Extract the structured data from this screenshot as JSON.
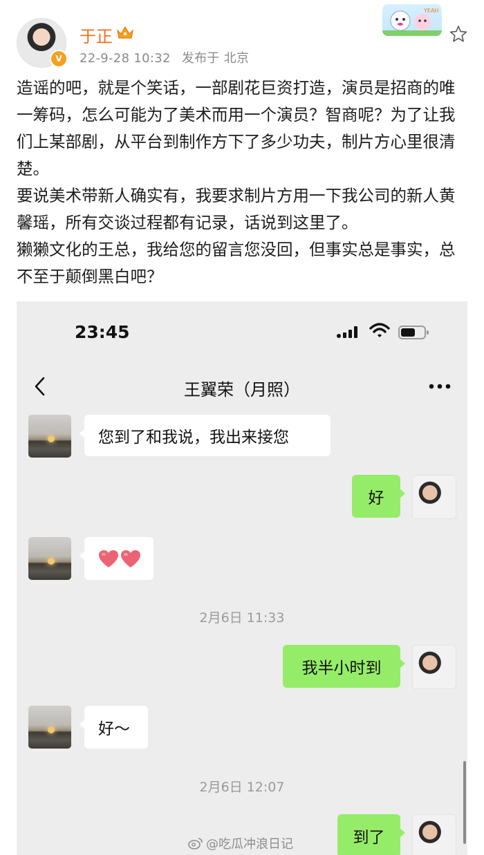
{
  "post": {
    "author": "于正",
    "date": "22-9-28 10:32",
    "source": "发布于 北京",
    "paragraphs": [
      "造谣的吧，就是个笑话，一部剧花巨资打造，演员是招商的唯一筹码，怎么可能为了美术而用一个演员？智商呢？为了让我们上某部剧，从平台到制作方下了多少功夫，制片方心里很清楚。",
      "要说美术带新人确实有，我要求制片方用一下我公司的新人黄馨瑶，所有交谈过程都有记录，话说到这里了。",
      "獭獭文化的王总，我给您的留言您没回，但事实总是事实，总不至于颠倒黑白吧？"
    ]
  },
  "chat": {
    "status_time": "23:45",
    "title": "王翼荣（月照）",
    "messages": [
      {
        "from": "contact",
        "text": "您到了和我说，我出来接您"
      },
      {
        "from": "me",
        "text": "好"
      },
      {
        "from": "contact",
        "text": "",
        "emoji": "hearts"
      },
      {
        "timestamp": "2月6日 11:33"
      },
      {
        "from": "me",
        "text": "我半小时到"
      },
      {
        "from": "contact",
        "text": "好～"
      },
      {
        "timestamp": "2月6日 12:07"
      },
      {
        "from": "me",
        "text": "到了"
      }
    ]
  },
  "watermark": "@吃瓜冲浪日记",
  "colors": {
    "author": "#f26d1a",
    "out_bubble": "#95ec69",
    "chat_bg": "#ededed"
  }
}
